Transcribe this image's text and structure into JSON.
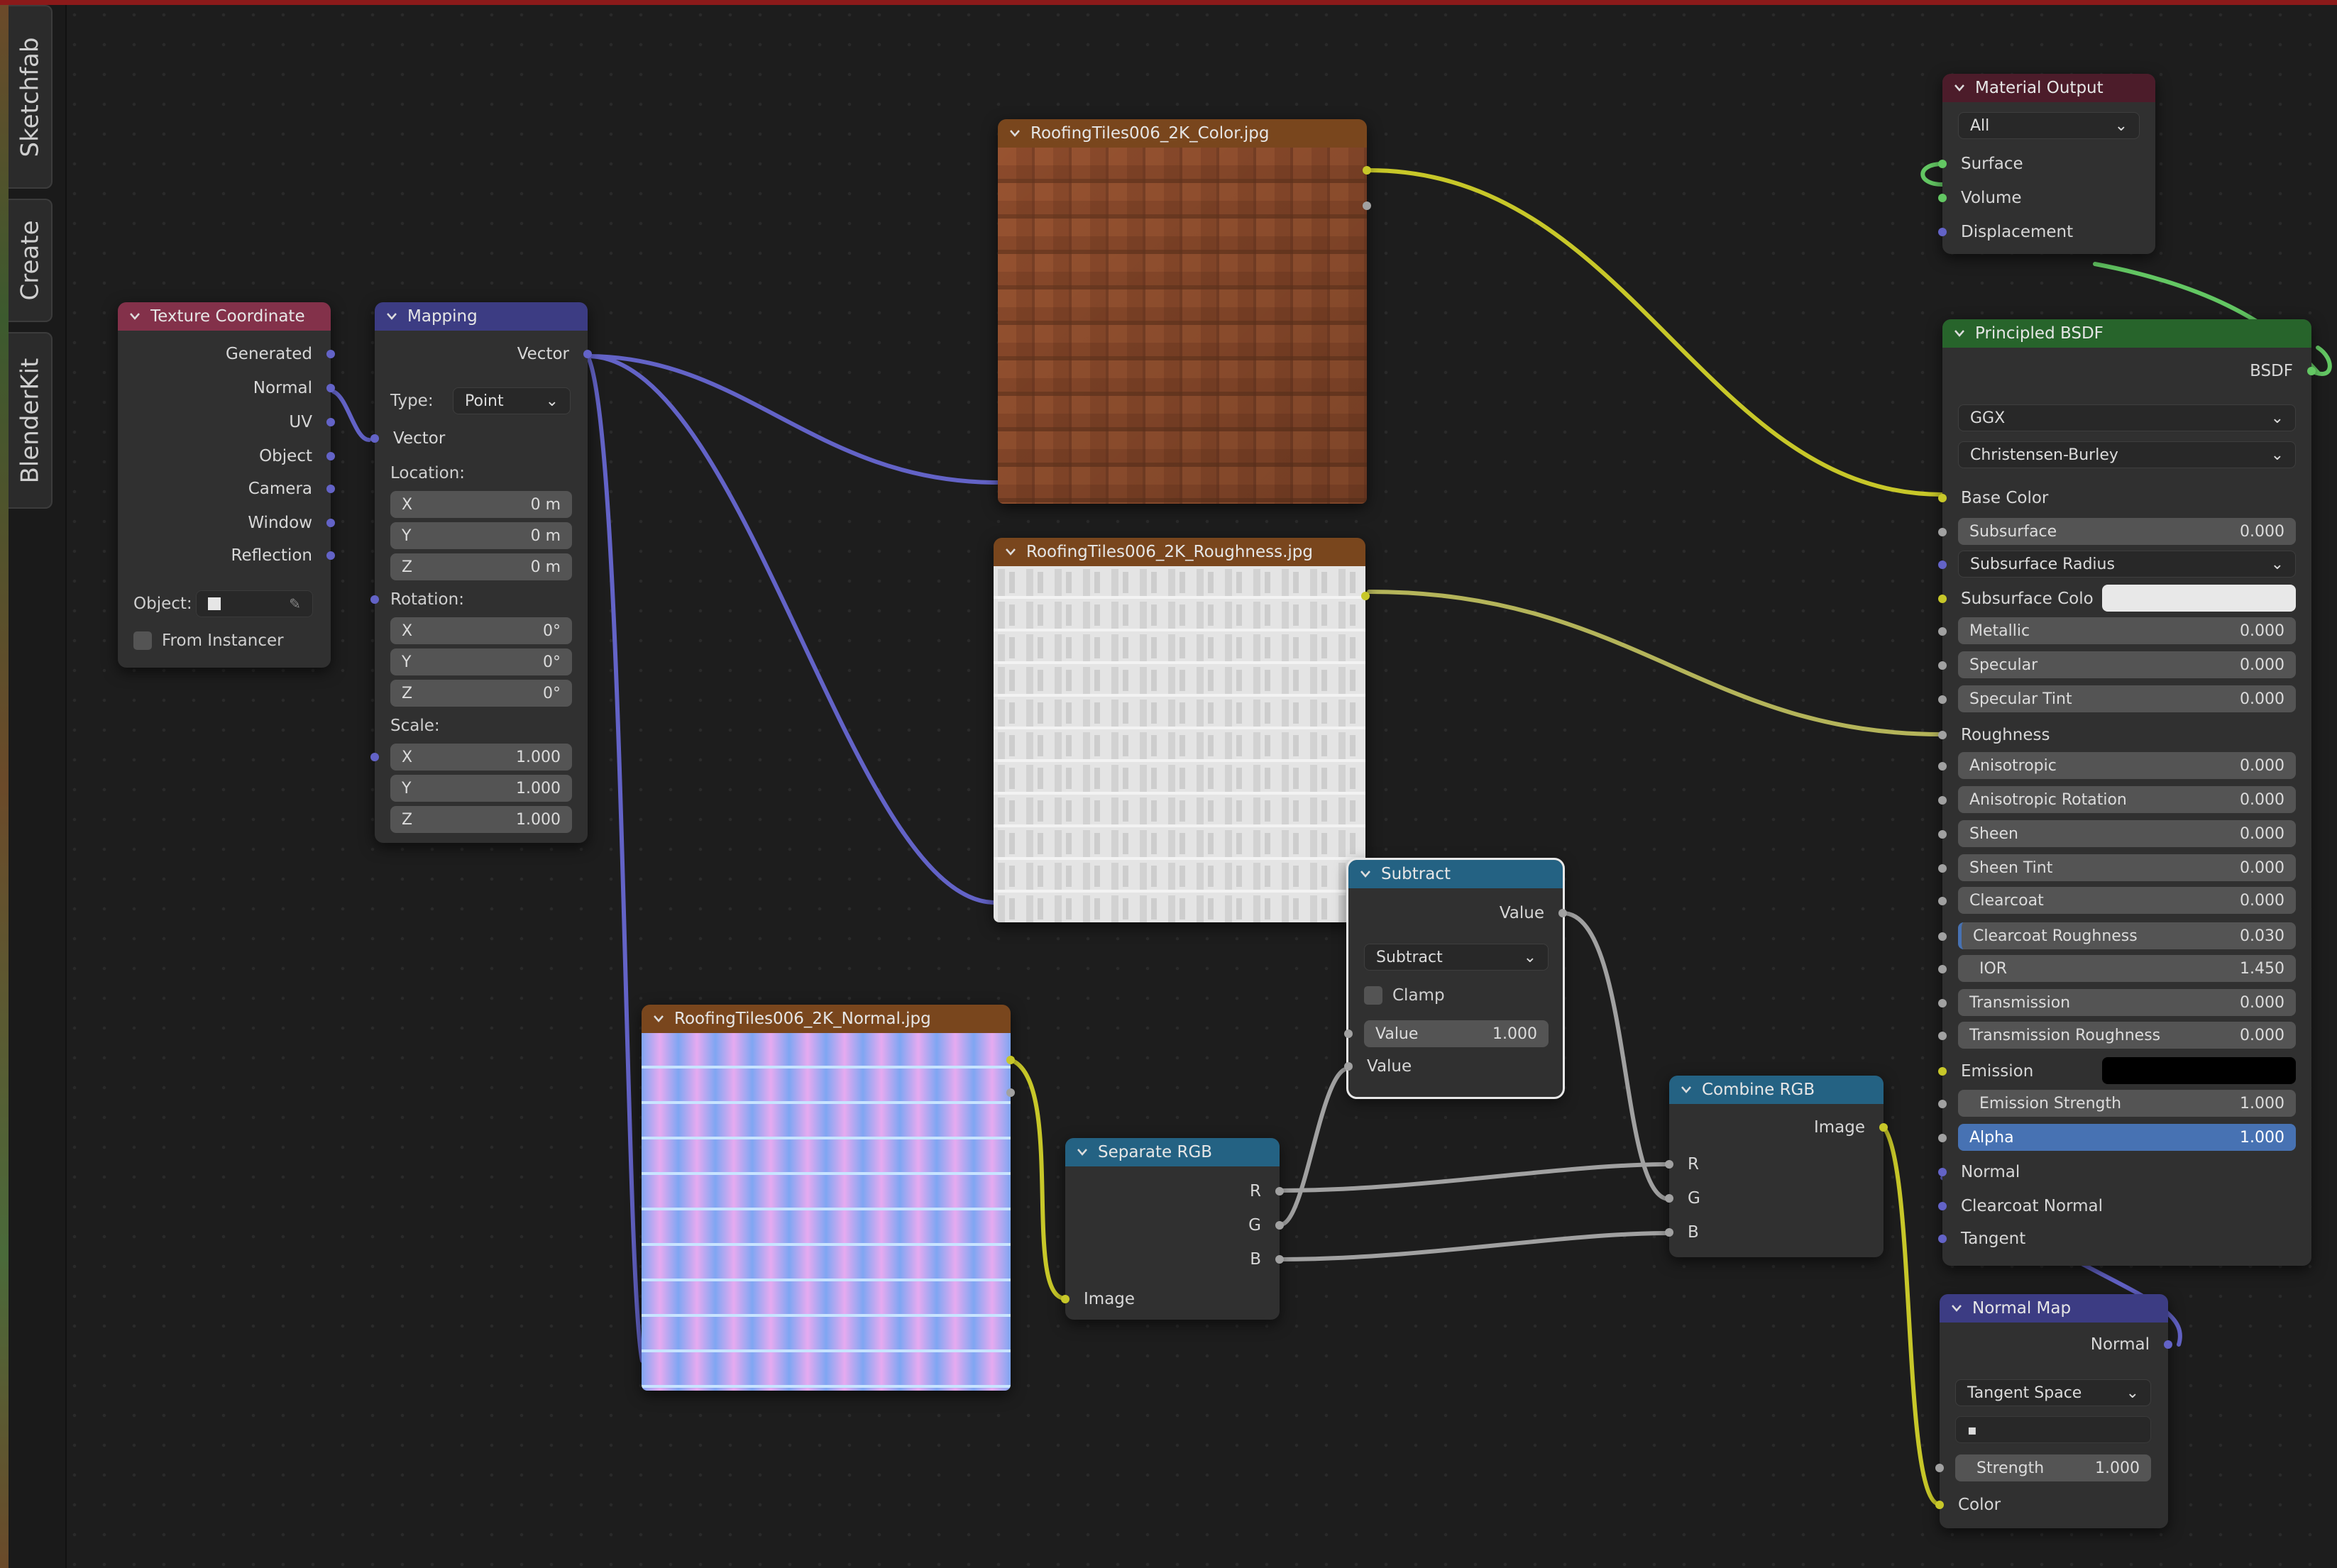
{
  "sidebar": {
    "tabs": [
      "Sketchfab",
      "Create",
      "BlenderKit"
    ]
  },
  "texcoord": {
    "title": "Texture Coordinate",
    "outputs": [
      "Generated",
      "Normal",
      "UV",
      "Object",
      "Camera",
      "Window",
      "Reflection"
    ],
    "object_label": "Object:",
    "from_instancer": "From Instancer"
  },
  "mapping": {
    "title": "Mapping",
    "output": "Vector",
    "type_label": "Type:",
    "type_value": "Point",
    "vector_label": "Vector",
    "location_label": "Location:",
    "location": [
      {
        "axis": "X",
        "value": "0 m"
      },
      {
        "axis": "Y",
        "value": "0 m"
      },
      {
        "axis": "Z",
        "value": "0 m"
      }
    ],
    "rotation_label": "Rotation:",
    "rotation": [
      {
        "axis": "X",
        "value": "0°"
      },
      {
        "axis": "Y",
        "value": "0°"
      },
      {
        "axis": "Z",
        "value": "0°"
      }
    ],
    "scale_label": "Scale:",
    "scale": [
      {
        "axis": "X",
        "value": "1.000"
      },
      {
        "axis": "Y",
        "value": "1.000"
      },
      {
        "axis": "Z",
        "value": "1.000"
      }
    ]
  },
  "color_tex": {
    "title": "RoofingTiles006_2K_Color.jpg"
  },
  "rough_tex": {
    "title": "RoofingTiles006_2K_Roughness.jpg"
  },
  "normal_tex": {
    "title": "RoofingTiles006_2K_Normal.jpg"
  },
  "subtract": {
    "title": "Subtract",
    "output": "Value",
    "operation": "Subtract",
    "clamp": "Clamp",
    "value_label": "Value",
    "value": "1.000",
    "input_label": "Value"
  },
  "separate": {
    "title": "Separate RGB",
    "outputs": [
      "R",
      "G",
      "B"
    ],
    "input": "Image"
  },
  "combine": {
    "title": "Combine RGB",
    "output": "Image",
    "inputs": [
      "R",
      "G",
      "B"
    ]
  },
  "output": {
    "title": "Material Output",
    "target": "All",
    "inputs": [
      "Surface",
      "Volume",
      "Displacement"
    ]
  },
  "principled": {
    "title": "Principled BSDF",
    "output": "BSDF",
    "distribution": "GGX",
    "subsurface_method": "Christensen-Burley",
    "base_color": "Base Color",
    "subsurface": {
      "label": "Subsurface",
      "value": "0.000"
    },
    "subsurface_radius": "Subsurface Radius",
    "subsurface_color": "Subsurface Colo",
    "metallic": {
      "label": "Metallic",
      "value": "0.000"
    },
    "specular": {
      "label": "Specular",
      "value": "0.000"
    },
    "specular_tint": {
      "label": "Specular Tint",
      "value": "0.000"
    },
    "roughness": "Roughness",
    "anisotropic": {
      "label": "Anisotropic",
      "value": "0.000"
    },
    "anisotropic_rotation": {
      "label": "Anisotropic Rotation",
      "value": "0.000"
    },
    "sheen": {
      "label": "Sheen",
      "value": "0.000"
    },
    "sheen_tint": {
      "label": "Sheen Tint",
      "value": "0.000"
    },
    "clearcoat": {
      "label": "Clearcoat",
      "value": "0.000"
    },
    "clearcoat_roughness": {
      "label": "Clearcoat Roughness",
      "value": "0.030"
    },
    "ior": {
      "label": "IOR",
      "value": "1.450"
    },
    "transmission": {
      "label": "Transmission",
      "value": "0.000"
    },
    "transmission_roughness": {
      "label": "Transmission Roughness",
      "value": "0.000"
    },
    "emission": "Emission",
    "emission_strength": {
      "label": "Emission Strength",
      "value": "1.000"
    },
    "alpha": {
      "label": "Alpha",
      "value": "1.000"
    },
    "normal": "Normal",
    "clearcoat_normal": "Clearcoat Normal",
    "tangent": "Tangent"
  },
  "normalmap": {
    "title": "Normal Map",
    "output": "Normal",
    "space": "Tangent Space",
    "strength": {
      "label": "Strength",
      "value": "1.000"
    },
    "input": "Color"
  },
  "colors": {
    "vector_socket": "#6363c7",
    "color_socket": "#c7c729",
    "value_socket": "#a1a1a1",
    "shader_socket": "#63c763",
    "selected_field": "#4772b3"
  }
}
